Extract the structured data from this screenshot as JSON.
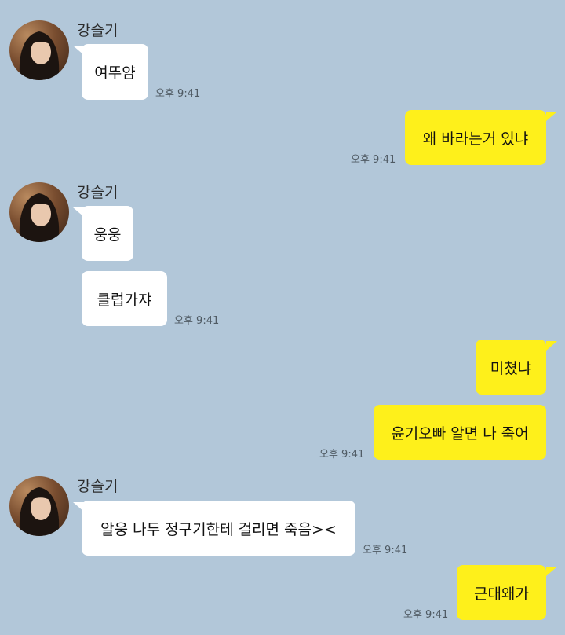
{
  "contact": {
    "name": "강슬기"
  },
  "messages": [
    {
      "sender": "contact",
      "text": "여뚜얌",
      "time": "오후 9:41"
    },
    {
      "sender": "me",
      "text": "왜 바라는거 있냐",
      "time": "오후 9:41"
    },
    {
      "sender": "contact",
      "text": "웅웅"
    },
    {
      "sender": "contact",
      "text": "클럽가쟈",
      "time": "오후 9:41"
    },
    {
      "sender": "me",
      "text": "미쳤냐"
    },
    {
      "sender": "me",
      "text": "윤기오빠 알면 나 죽어",
      "time": "오후 9:41"
    },
    {
      "sender": "contact",
      "text": "알웅 나두 정구기한테 걸리면 죽음><",
      "time": "오후 9:41"
    },
    {
      "sender": "me",
      "text": "근대왜가",
      "time": "오후 9:41"
    }
  ],
  "colors": {
    "background": "#b2c7d9",
    "incoming_bubble": "#ffffff",
    "outgoing_bubble": "#fef01b"
  },
  "icons": {
    "avatar": "profile-photo"
  }
}
